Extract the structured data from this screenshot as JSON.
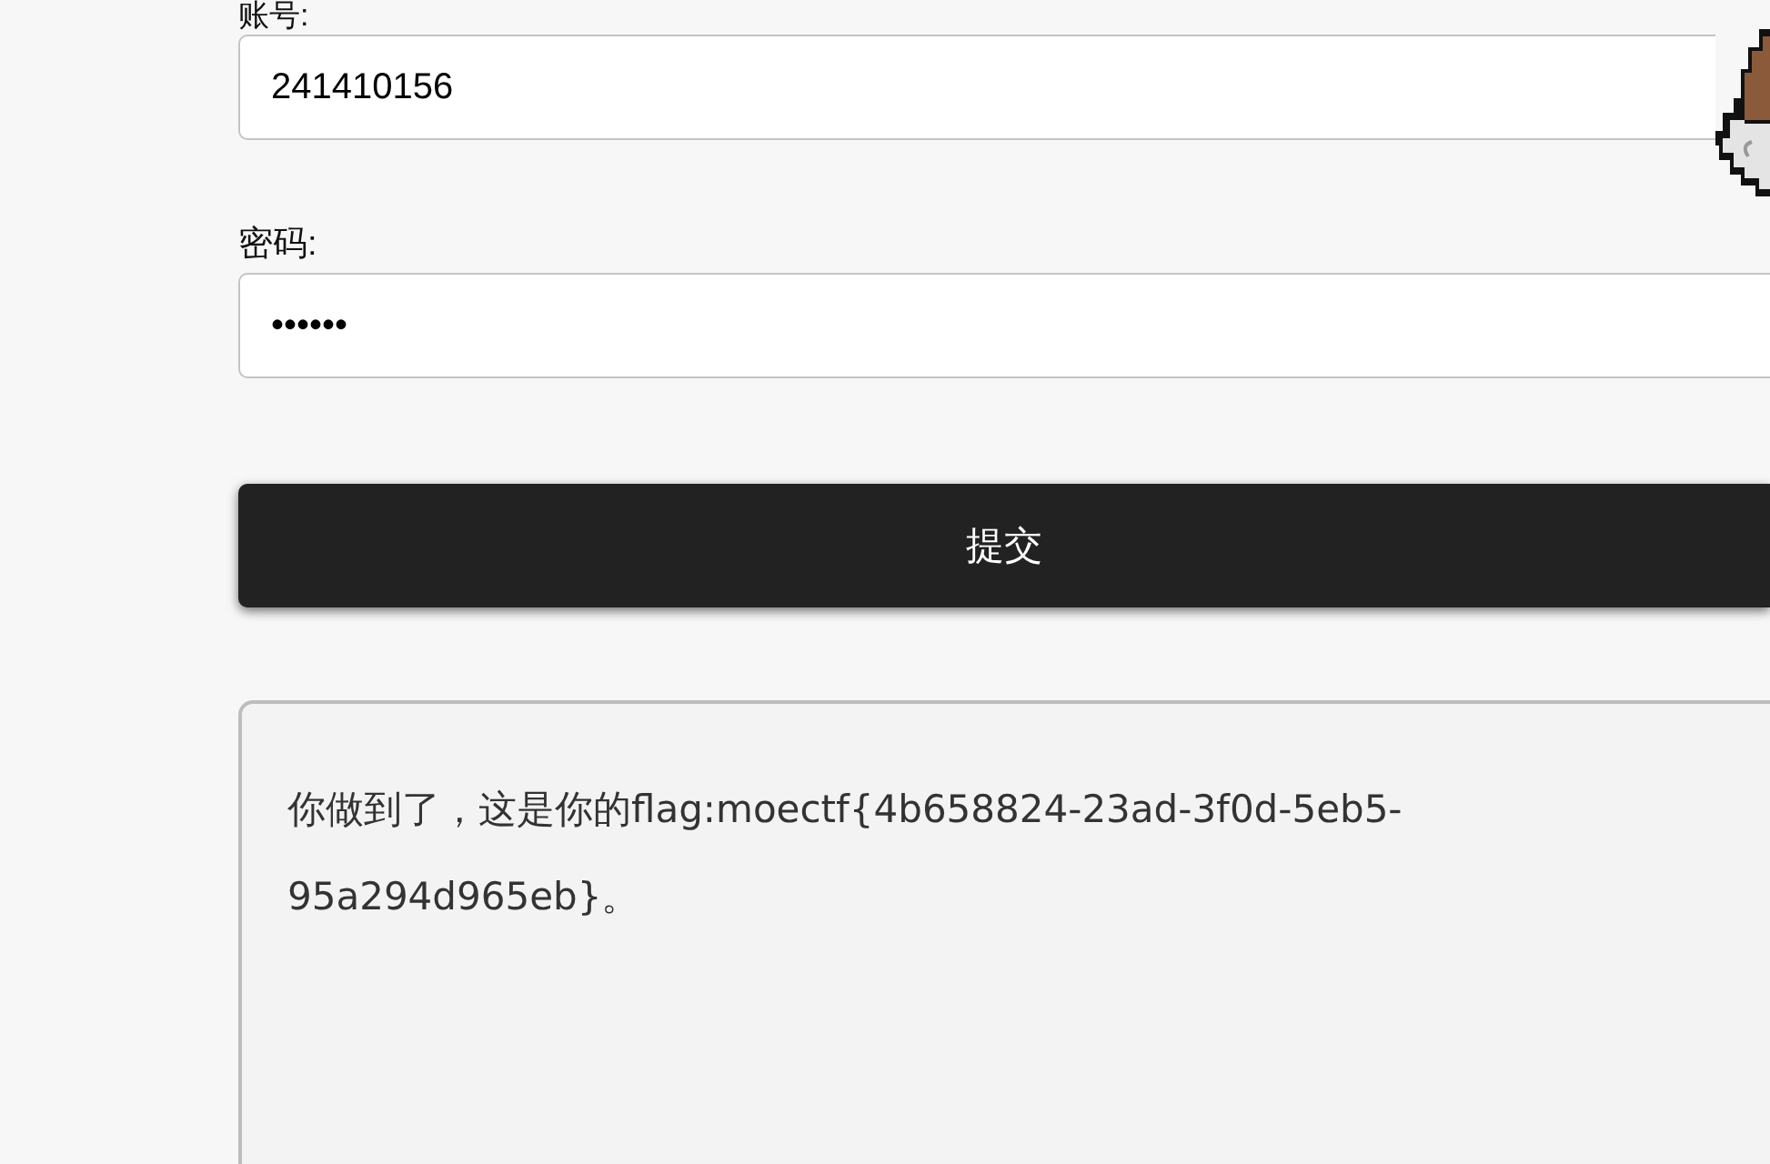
{
  "form": {
    "fields": [
      {
        "label": "账号:",
        "value": "241410156"
      },
      {
        "label": "密码:",
        "value": "••••••"
      }
    ],
    "submit_button": "提交",
    "message": "你做到了，这是你的flag:moectf{4b658824-23ad-3f0d-5eb5-95a294d965eb}。"
  }
}
